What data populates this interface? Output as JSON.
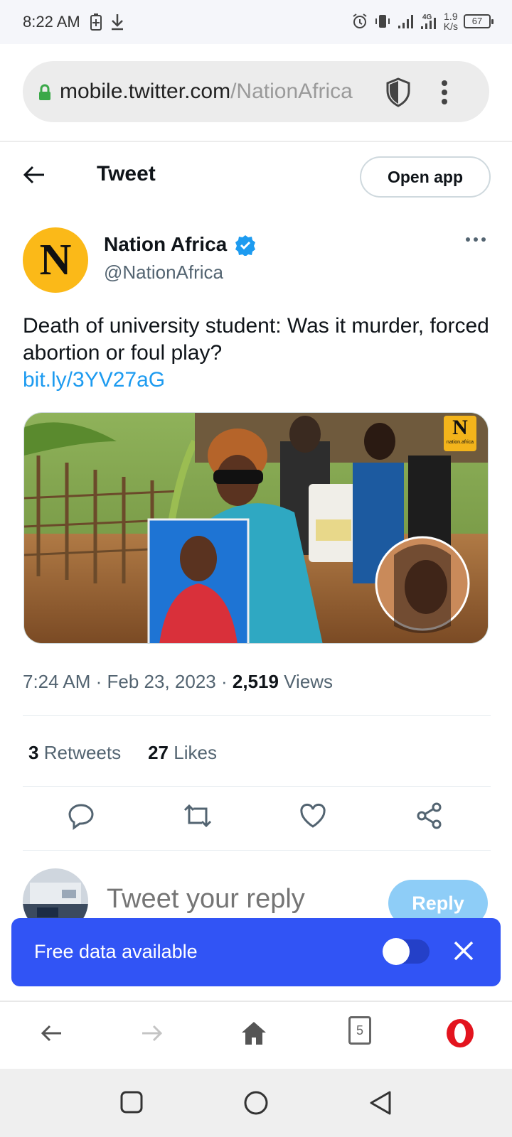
{
  "status_bar": {
    "time": "8:22 AM",
    "network_speed_value": "1.9",
    "network_speed_unit": "K/s",
    "network_type": "4G",
    "battery": "67",
    "icons": [
      "battery-saver-icon",
      "download-icon",
      "alarm-icon",
      "vibrate-icon",
      "signal-icon",
      "signal-4g-icon",
      "battery-icon"
    ]
  },
  "browser": {
    "url_host": "mobile.twitter.com",
    "url_path": "/NationAfrica",
    "tab_count": "5"
  },
  "header": {
    "title": "Tweet",
    "open_app_label": "Open app"
  },
  "tweet": {
    "author_name": "Nation Africa",
    "author_handle": "@NationAfrica",
    "avatar_letter": "N",
    "text": "Death of university student: Was it murder, forced abortion or foul play?",
    "link": "bit.ly/3YV27aG",
    "media_badge_letter": "N",
    "media_badge_caption": "nation.africa",
    "time": "7:24 AM",
    "date": "Feb 23, 2023",
    "views_count": "2,519",
    "views_label": "Views",
    "retweets_count": "3",
    "retweets_label": "Retweets",
    "likes_count": "27",
    "likes_label": "Likes"
  },
  "reply": {
    "placeholder": "Tweet your reply",
    "button_label": "Reply"
  },
  "toast": {
    "text": "Free data available",
    "toggle_on": false
  },
  "colors": {
    "accent": "#1d9bf0",
    "toast_bg": "#3154f5",
    "opera_red": "#e3141e",
    "nation_yellow": "#fbb918"
  }
}
